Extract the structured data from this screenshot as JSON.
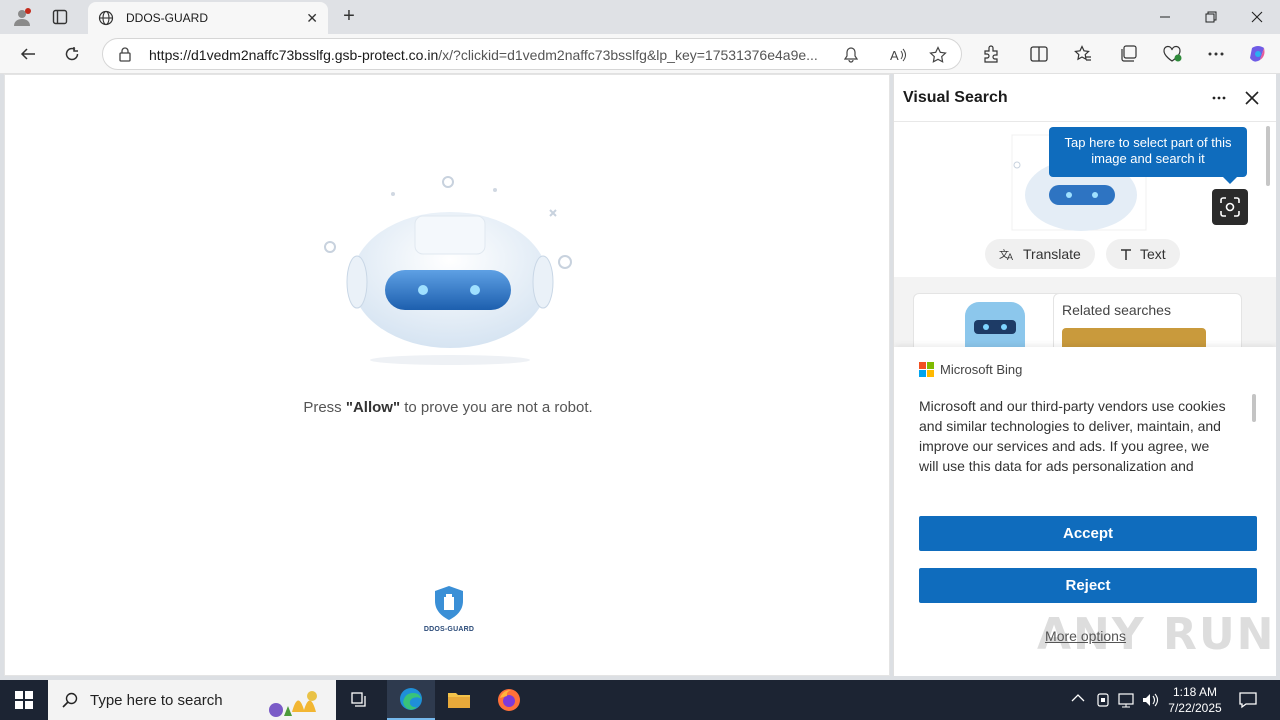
{
  "browser": {
    "tab_title": "DDOS-GUARD",
    "url_host": "https://d1vedm2naffc73bsslfg.gsb-protect.co.in",
    "url_rest": "/x/?clickid=d1vedm2naffc73bsslfg&lp_key=17531376e4a9e..."
  },
  "page": {
    "prompt_pre": "Press ",
    "prompt_bold": "\"Allow\"",
    "prompt_post": " to prove you are not a robot.",
    "brand_name": "DDOS-GUARD"
  },
  "panel": {
    "title": "Visual Search",
    "tooltip": "Tap here to select part of this image and search it",
    "translate_label": "Translate",
    "text_label": "Text",
    "related_label": "Related searches"
  },
  "consent": {
    "brand": "Microsoft Bing",
    "text": "Microsoft and our third-party vendors use cookies and similar technologies to deliver, maintain, and improve our services and ads. If you agree, we will use this data for ads personalization and",
    "accept_label": "Accept",
    "reject_label": "Reject",
    "more_options": "More options",
    "watermark": "ANY RUN"
  },
  "taskbar": {
    "search_placeholder": "Type here to search",
    "time": "1:18 AM",
    "date": "7/22/2025"
  },
  "colors": {
    "accent": "#0f6cbd",
    "taskbar": "#1c2433"
  }
}
